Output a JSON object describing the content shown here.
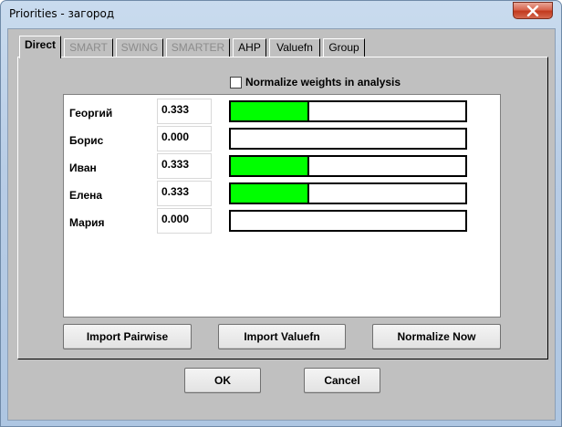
{
  "window": {
    "title": "Priorities - загород"
  },
  "tabs": [
    {
      "label": "Direct",
      "state": "active"
    },
    {
      "label": "SMART",
      "state": "disabled"
    },
    {
      "label": "SWING",
      "state": "disabled"
    },
    {
      "label": "SMARTER",
      "state": "disabled"
    },
    {
      "label": "AHP",
      "state": "enabled"
    },
    {
      "label": "Valuefn",
      "state": "enabled"
    },
    {
      "label": "Group",
      "state": "enabled"
    }
  ],
  "normalize": {
    "label": "Normalize weights in analysis",
    "checked": false
  },
  "rows": [
    {
      "name": "Георгий",
      "value": "0.333",
      "weight": 0.333
    },
    {
      "name": "Борис",
      "value": "0.000",
      "weight": 0.0
    },
    {
      "name": "Иван",
      "value": "0.333",
      "weight": 0.333
    },
    {
      "name": "Елена",
      "value": "0.333",
      "weight": 0.333
    },
    {
      "name": "Мария",
      "value": "0.000",
      "weight": 0.0
    }
  ],
  "actions": {
    "import_pairwise": "Import Pairwise",
    "import_valuefn": "Import Valuefn",
    "normalize_now": "Normalize Now"
  },
  "dialog": {
    "ok": "OK",
    "cancel": "Cancel"
  },
  "colors": {
    "bar_fill": "#00ff00",
    "close_button": "#c8432a"
  }
}
